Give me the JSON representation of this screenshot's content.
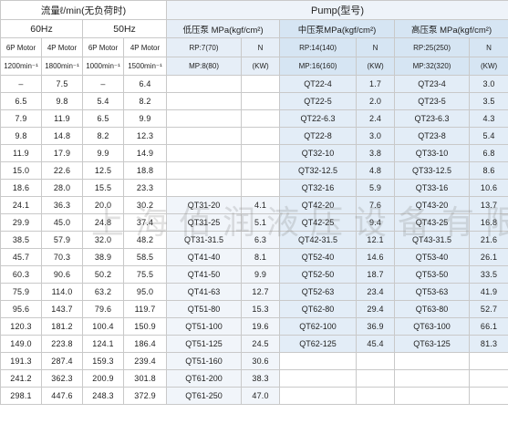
{
  "header": {
    "flow_title": "流量ℓ/min(无负荷时)",
    "pump_title": "Pump(型号)",
    "freq_60": "60Hz",
    "freq_50": "50Hz",
    "low_pump": "低压泵 MPa(kgf/cm²)",
    "mid_pump": "中压泵MPa(kgf/cm²)",
    "high_pump": "高压泵 MPa(kgf/cm²)",
    "motor_6p_60": "6P Motor",
    "motor_4p_60": "4P Motor",
    "motor_6p_50": "6P Motor",
    "motor_4p_50": "4P Motor",
    "low_rp": "RP:7(70)",
    "mid_rp": "RP:14(140)",
    "high_rp": "RP:25(250)",
    "n_low": "N",
    "n_mid": "N",
    "n_high": "N",
    "rpm_1200": "1200min⁻¹",
    "rpm_1800": "1800min⁻¹",
    "rpm_1000": "1000min⁻¹",
    "rpm_1500": "1500min⁻¹",
    "low_mp": "MP:8(80)",
    "mid_mp": "MP:16(160)",
    "high_mp": "MP:32(320)",
    "kw_low": "(KW)",
    "kw_mid": "(KW)",
    "kw_high": "(KW)"
  },
  "rows": [
    [
      "–",
      "7.5",
      "–",
      "6.4",
      "",
      "",
      "QT22-4",
      "1.7",
      "QT23-4",
      "3.0"
    ],
    [
      "6.5",
      "9.8",
      "5.4",
      "8.2",
      "",
      "",
      "QT22-5",
      "2.0",
      "QT23-5",
      "3.5"
    ],
    [
      "7.9",
      "11.9",
      "6.5",
      "9.9",
      "",
      "",
      "QT22-6.3",
      "2.4",
      "QT23-6.3",
      "4.3"
    ],
    [
      "9.8",
      "14.8",
      "8.2",
      "12.3",
      "",
      "",
      "QT22-8",
      "3.0",
      "QT23-8",
      "5.4"
    ],
    [
      "11.9",
      "17.9",
      "9.9",
      "14.9",
      "",
      "",
      "QT32-10",
      "3.8",
      "QT33-10",
      "6.8"
    ],
    [
      "15.0",
      "22.6",
      "12.5",
      "18.8",
      "",
      "",
      "QT32-12.5",
      "4.8",
      "QT33-12.5",
      "8.6"
    ],
    [
      "18.6",
      "28.0",
      "15.5",
      "23.3",
      "",
      "",
      "QT32-16",
      "5.9",
      "QT33-16",
      "10.6"
    ],
    [
      "24.1",
      "36.3",
      "20.0",
      "30.2",
      "QT31-20",
      "4.1",
      "QT42-20",
      "7.6",
      "QT43-20",
      "13.7"
    ],
    [
      "29.9",
      "45.0",
      "24.8",
      "37.4",
      "QT31-25",
      "5.1",
      "QT42-25",
      "9.4",
      "QT43-25",
      "16.8"
    ],
    [
      "38.5",
      "57.9",
      "32.0",
      "48.2",
      "QT31-31.5",
      "6.3",
      "QT42-31.5",
      "12.1",
      "QT43-31.5",
      "21.6"
    ],
    [
      "45.7",
      "70.3",
      "38.9",
      "58.5",
      "QT41-40",
      "8.1",
      "QT52-40",
      "14.6",
      "QT53-40",
      "26.1"
    ],
    [
      "60.3",
      "90.6",
      "50.2",
      "75.5",
      "QT41-50",
      "9.9",
      "QT52-50",
      "18.7",
      "QT53-50",
      "33.5"
    ],
    [
      "75.9",
      "114.0",
      "63.2",
      "95.0",
      "QT41-63",
      "12.7",
      "QT52-63",
      "23.4",
      "QT53-63",
      "41.9"
    ],
    [
      "95.6",
      "143.7",
      "79.6",
      "119.7",
      "QT51-80",
      "15.3",
      "QT62-80",
      "29.4",
      "QT63-80",
      "52.7"
    ],
    [
      "120.3",
      "181.2",
      "100.4",
      "150.9",
      "QT51-100",
      "19.6",
      "QT62-100",
      "36.9",
      "QT63-100",
      "66.1"
    ],
    [
      "149.0",
      "223.8",
      "124.1",
      "186.4",
      "QT51-125",
      "24.5",
      "QT62-125",
      "45.4",
      "QT63-125",
      "81.3"
    ],
    [
      "191.3",
      "287.4",
      "159.3",
      "239.4",
      "QT51-160",
      "30.6",
      "",
      "",
      "",
      ""
    ],
    [
      "241.2",
      "362.3",
      "200.9",
      "301.8",
      "QT61-200",
      "38.3",
      "",
      "",
      "",
      ""
    ],
    [
      "298.1",
      "447.6",
      "248.3",
      "372.9",
      "QT61-250",
      "47.0",
      "",
      "",
      "",
      ""
    ]
  ],
  "watermark": "上海佰润液压设备有限公司"
}
